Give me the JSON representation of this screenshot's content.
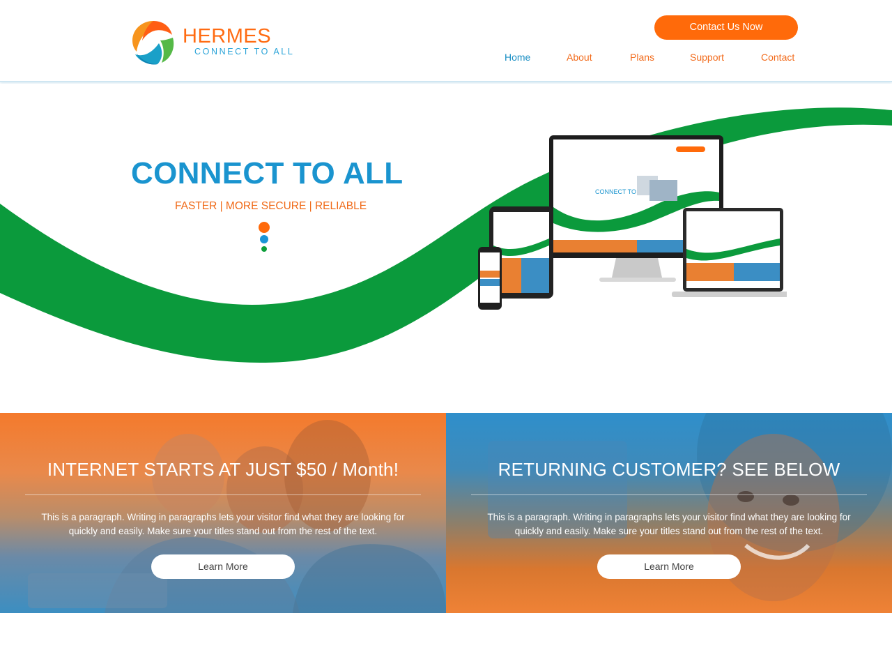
{
  "brand": {
    "name": "HERMES",
    "tagline": "CONNECT TO ALL",
    "logo_icon": "hermes-logo-icon",
    "colors": {
      "orange": "#ff6a0a",
      "blue": "#1a94cf",
      "green": "#0d9e3a"
    }
  },
  "header": {
    "cta_label": "Contact Us Now",
    "nav": [
      {
        "label": "Home",
        "active": true
      },
      {
        "label": "About",
        "active": false
      },
      {
        "label": "Plans",
        "active": false
      },
      {
        "label": "Support",
        "active": false
      },
      {
        "label": "Contact",
        "active": false
      }
    ]
  },
  "hero": {
    "title": "CONNECT TO ALL",
    "subtitle": "FASTER | MORE SECURE | RELIABLE",
    "image": "responsive-devices-mockup"
  },
  "promos": [
    {
      "title": "INTERNET STARTS AT JUST $50 / Month!",
      "text": "This is a paragraph. Writing in paragraphs lets your visitor find what they are looking for quickly and easily. Make sure your titles stand out from the rest of the text.",
      "button_label": "Learn More",
      "image": "couple-laptop-photo"
    },
    {
      "title": "RETURNING CUSTOMER? SEE BELOW",
      "text": "This is a paragraph. Writing in paragraphs lets your visitor find what they are looking for quickly and easily. Make sure your titles stand out from the rest of the text.",
      "button_label": "Learn More",
      "image": "smiling-woman-photo"
    }
  ]
}
